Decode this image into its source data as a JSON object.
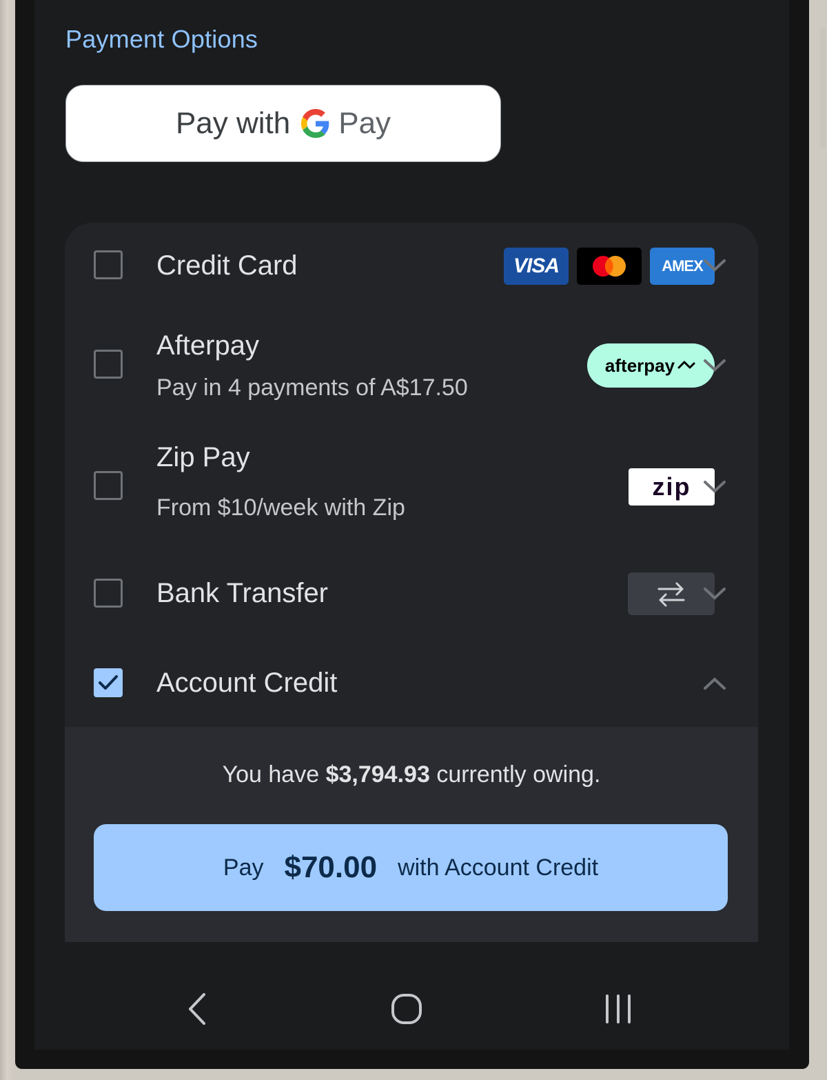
{
  "section_title": "Payment Options",
  "gpay": {
    "prefix": "Pay with",
    "brand": "Pay"
  },
  "options": [
    {
      "id": "credit-card",
      "title": "Credit Card",
      "checked": false,
      "expanded": false,
      "badges": [
        "VISA",
        "mastercard",
        "AMEX"
      ]
    },
    {
      "id": "afterpay",
      "title": "Afterpay",
      "subtitle": "Pay in 4 payments of A$17.50",
      "checked": false,
      "expanded": false,
      "badge": "afterpay"
    },
    {
      "id": "zip-pay",
      "title": "Zip Pay",
      "subtitle": "From $10/week with Zip",
      "checked": false,
      "expanded": false,
      "badge": "zip"
    },
    {
      "id": "bank-transfer",
      "title": "Bank Transfer",
      "checked": false,
      "expanded": false,
      "badge_icon": "transfer-arrows-icon"
    },
    {
      "id": "account-credit",
      "title": "Account Credit",
      "checked": true,
      "expanded": true
    }
  ],
  "account_credit": {
    "owing_prefix": "You have",
    "owing_amount": "$3,794.93",
    "owing_suffix": "currently owing.",
    "pay_word": "Pay",
    "pay_amount": "$70.00",
    "pay_suffix": "with Account Credit"
  },
  "nav": {
    "back_icon": "back-chevron-icon",
    "home_icon": "home-icon",
    "recents_icon": "recents-icon"
  },
  "colors": {
    "accent": "#9ecaff",
    "title": "#8fc3ff",
    "background": "#1b1c1e",
    "card": "#222428"
  }
}
